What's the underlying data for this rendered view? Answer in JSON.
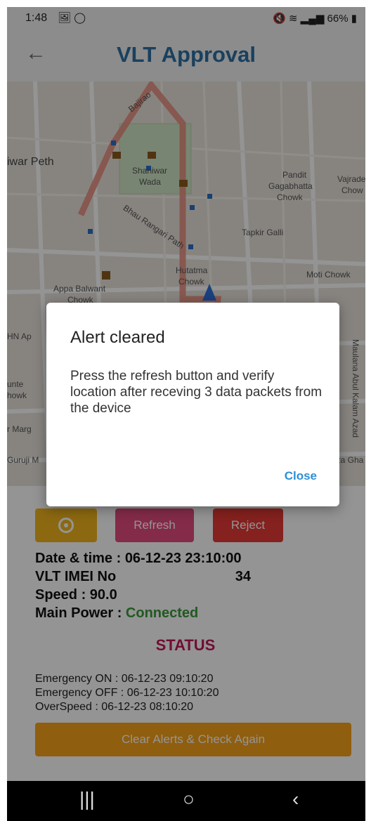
{
  "status_bar": {
    "time": "1:48",
    "left_icons": "🖼 ◯",
    "right_text": "66%"
  },
  "app_bar": {
    "back_icon": "arrow-left-icon",
    "title": "VLT Approval"
  },
  "map": {
    "labels": [
      "iwar Peth",
      "Shaniwar",
      "Wada",
      "Pandit",
      "Gagabhatta",
      "Chowk",
      "Vajrade",
      "Chow",
      "Tapkir Galli",
      "Bhau Rangari Path",
      "Hutatma",
      "Chowk",
      "Moti Chowk",
      "Appa Balwant",
      "Chowk",
      "HN Ap",
      "unte",
      "howk",
      "r Marg",
      "Guruji M",
      "Maulana Abul Kalam Azad",
      "irza Gha",
      "Bajirao"
    ]
  },
  "controls": {
    "locate_icon": "crosshair-icon",
    "refresh_label": "Refresh",
    "reject_label": "Reject",
    "date_time_label": "Date & time : ",
    "date_time_value": "06-12-23 23:10:00",
    "imei_label": "VLT IMEI No",
    "imei_visible_suffix": "34",
    "speed_label": "Speed : ",
    "speed_value": "90.0",
    "power_label": "Main Power : ",
    "power_value": "Connected",
    "status_heading": "STATUS",
    "log": [
      "Emergency ON : 06-12-23 09:10:20",
      "Emergency OFF : 06-12-23 10:10:20",
      "OverSpeed : 06-12-23 08:10:20"
    ],
    "clear_label": "Clear Alerts & Check Again"
  },
  "dialog": {
    "title": "Alert cleared",
    "body": "Press the refresh button and verify location after receving 3 data packets from the device",
    "close_label": "Close"
  },
  "nav_bar": {
    "recents_glyph": "|||",
    "home_glyph": "○",
    "back_glyph": "‹"
  },
  "colors": {
    "title": "#2d6fa3",
    "refresh": "#e44a7f",
    "reject": "#e53935",
    "locate": "#f2b51e",
    "clear": "#f7a21b",
    "status_heading": "#c2185b",
    "connected": "#3a9a3a",
    "dialog_close": "#2b8fd6"
  }
}
